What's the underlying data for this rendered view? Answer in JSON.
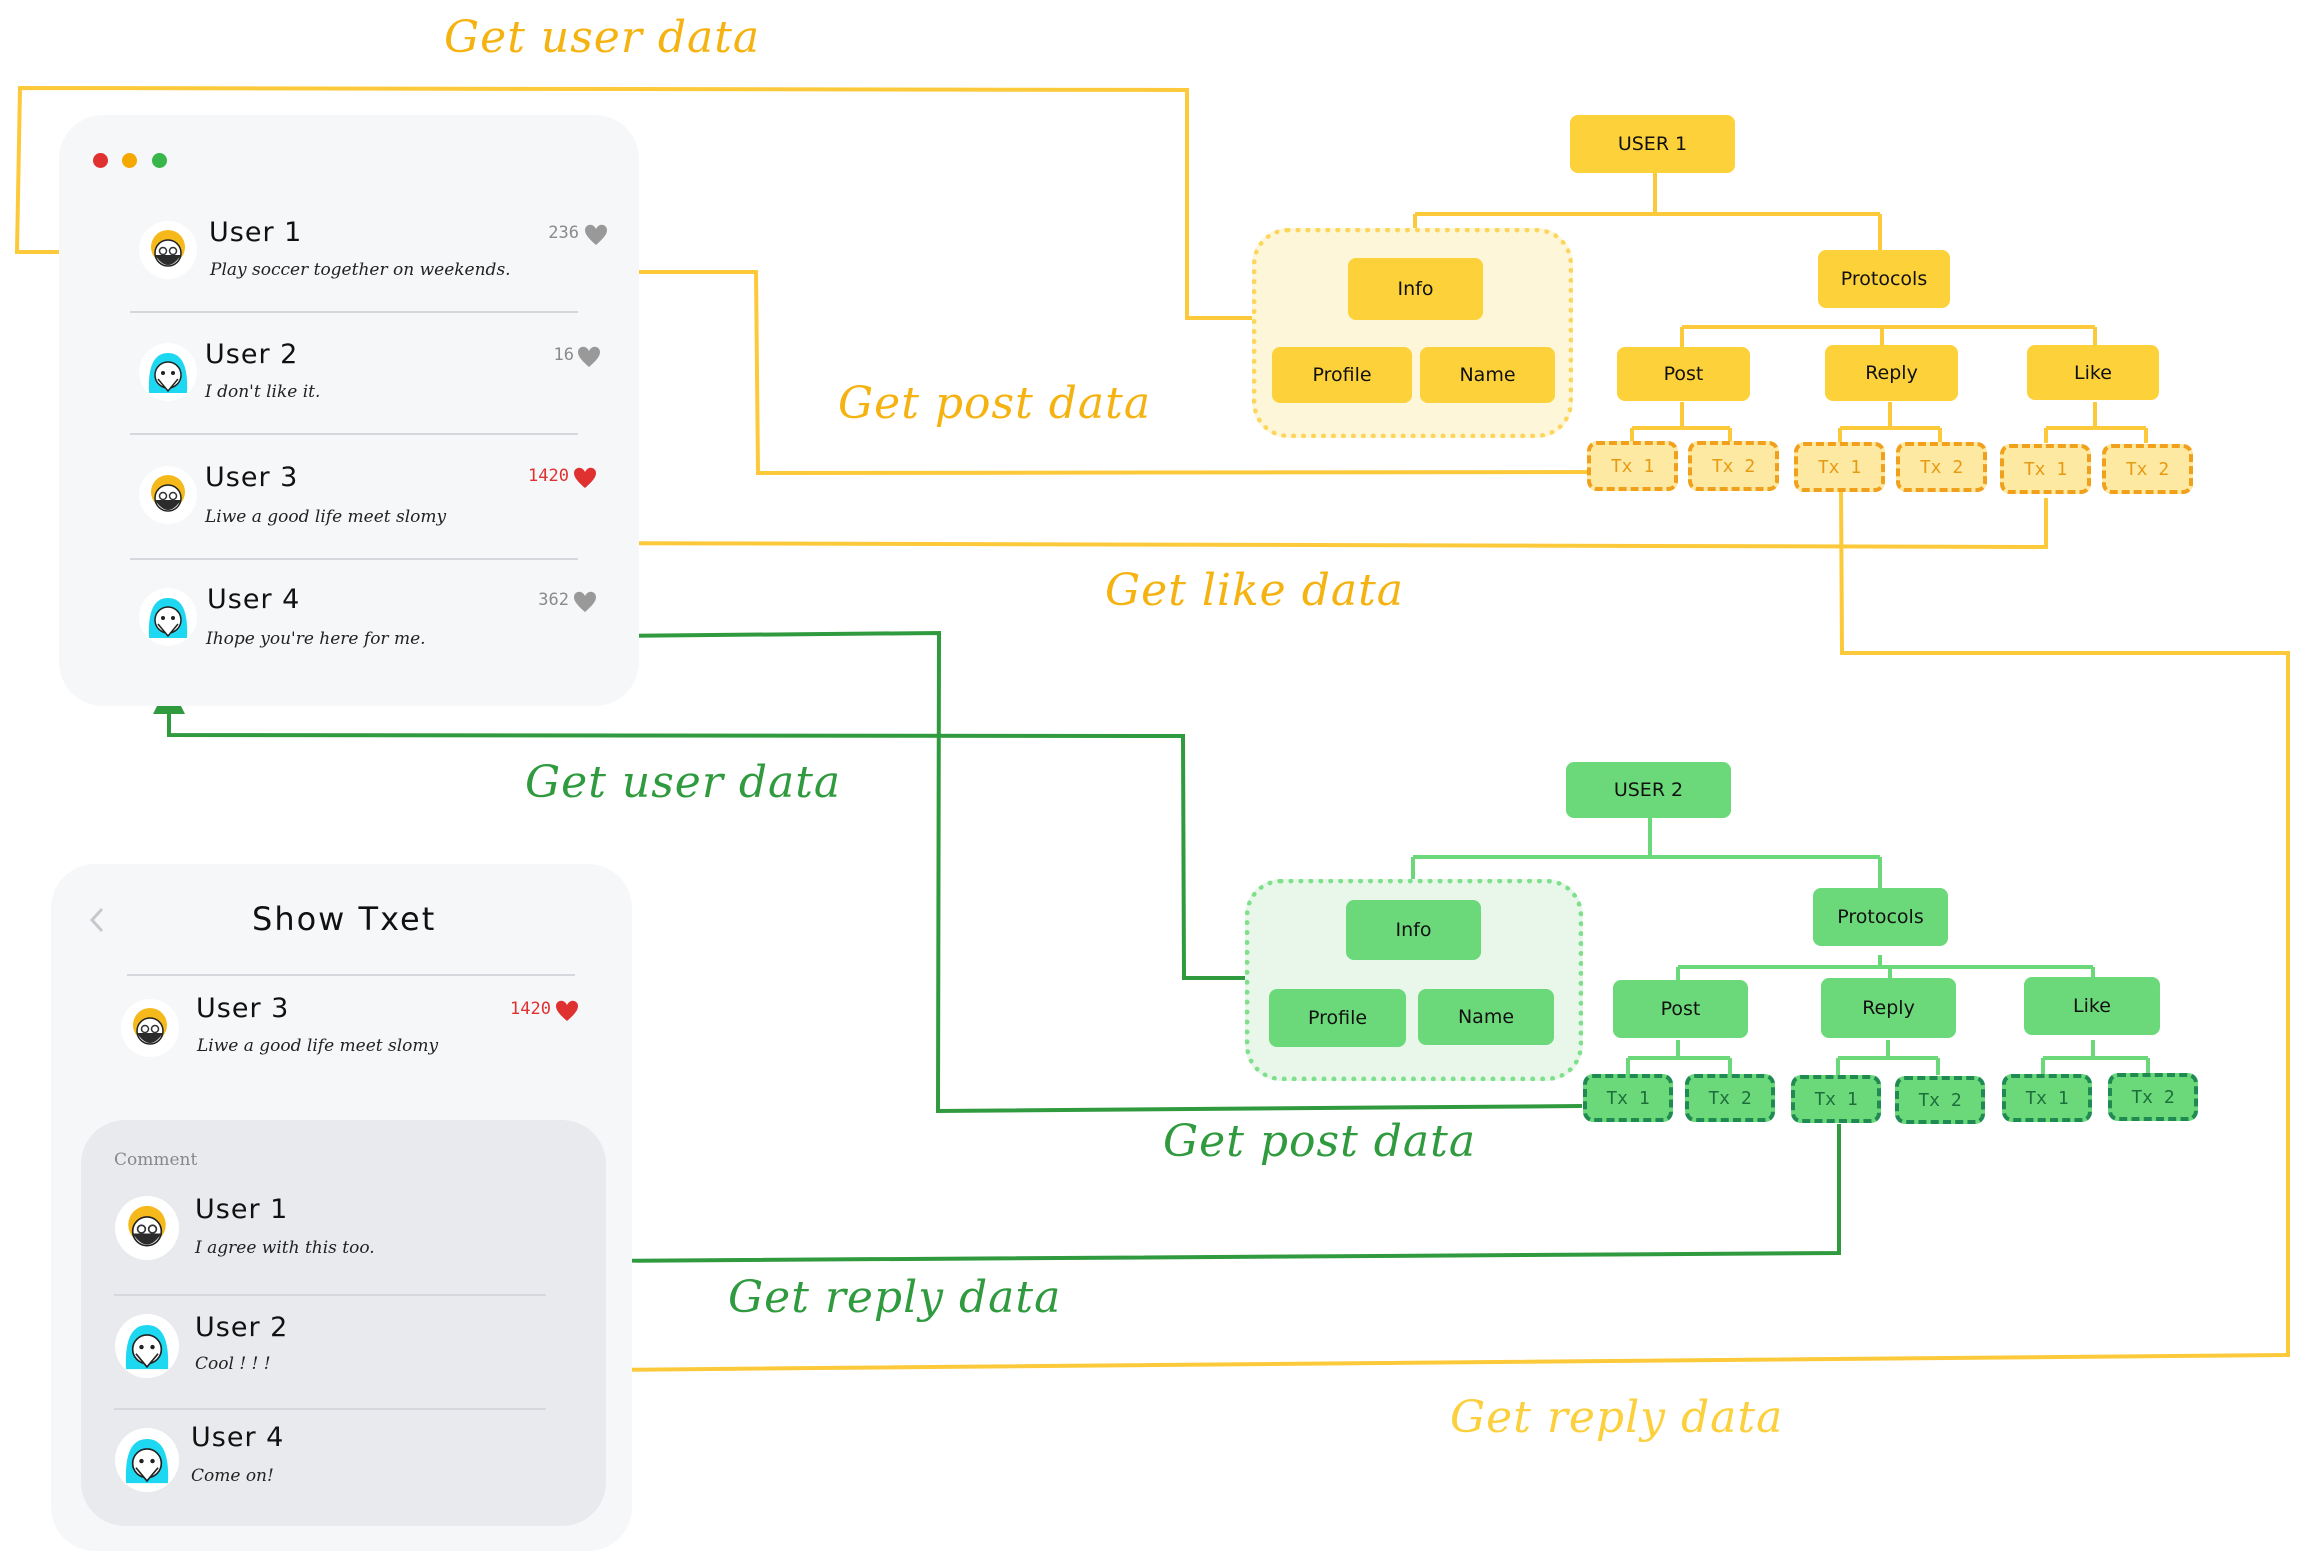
{
  "feed_window": {
    "window_controls": [
      {
        "name": "close",
        "color": "#e03131"
      },
      {
        "name": "minimize",
        "color": "#f5a800"
      },
      {
        "name": "maximize",
        "color": "#38b64a"
      }
    ],
    "posts": [
      {
        "user": "User 1",
        "message": "Play soccer together on weekends.",
        "likes": "236",
        "liked": false,
        "avatar": "yellow-hair-masked"
      },
      {
        "user": "User 2",
        "message": "I don't like it.",
        "likes": "16",
        "liked": false,
        "avatar": "cyan-hair-masked"
      },
      {
        "user": "User 3",
        "message": "Liwe a good life meet slomy",
        "likes": "1420",
        "liked": true,
        "avatar": "yellow-hair-masked"
      },
      {
        "user": "User 4",
        "message": "Ihope you're here for me.",
        "likes": "362",
        "liked": false,
        "avatar": "cyan-hair-masked"
      }
    ]
  },
  "detail_window": {
    "back_icon": "chevron-left",
    "title": "Show Txet",
    "post": {
      "user": "User 3",
      "message": "Liwe a good life meet slomy",
      "likes": "1420",
      "liked": true
    },
    "comment_section_title": "Comment",
    "comments": [
      {
        "user": "User 1",
        "message": "I agree with this too."
      },
      {
        "user": "User 2",
        "message": "Cool ! ! !"
      },
      {
        "user": "User 4",
        "message": "Come on!"
      }
    ]
  },
  "trees": [
    {
      "root": "USER 1",
      "color": "#fdd13a",
      "info": {
        "label": "Info",
        "children": [
          "Profile",
          "Name"
        ]
      },
      "protocols": {
        "label": "Protocols",
        "children": [
          {
            "label": "Post",
            "tx": [
              "Tx 1",
              "Tx 2"
            ]
          },
          {
            "label": "Reply",
            "tx": [
              "Tx 1",
              "Tx 2"
            ]
          },
          {
            "label": "Like",
            "tx": [
              "Tx 1",
              "Tx 2"
            ]
          }
        ]
      }
    },
    {
      "root": "USER 2",
      "color": "#6bd97a",
      "info": {
        "label": "Info",
        "children": [
          "Profile",
          "Name"
        ]
      },
      "protocols": {
        "label": "Protocols",
        "children": [
          {
            "label": "Post",
            "tx": [
              "Tx 1",
              "Tx 2"
            ]
          },
          {
            "label": "Reply",
            "tx": [
              "Tx 1",
              "Tx 2"
            ]
          },
          {
            "label": "Like",
            "tx": [
              "Tx 1",
              "Tx 2"
            ]
          }
        ]
      }
    }
  ],
  "flow_labels": {
    "yellow_user": "Get user data",
    "yellow_post": "Get post data",
    "yellow_like": "Get like data",
    "yellow_reply": "Get reply data",
    "green_user": "Get user data",
    "green_post": "Get post data",
    "green_reply": "Get reply data"
  },
  "colors": {
    "yellow_line": "#fcc93a",
    "yellow_text": "#f5b312",
    "green_line": "#2f9a3e",
    "green_tree_line": "#6bd97a",
    "like_red": "#e03131",
    "like_grey": "#999999"
  }
}
